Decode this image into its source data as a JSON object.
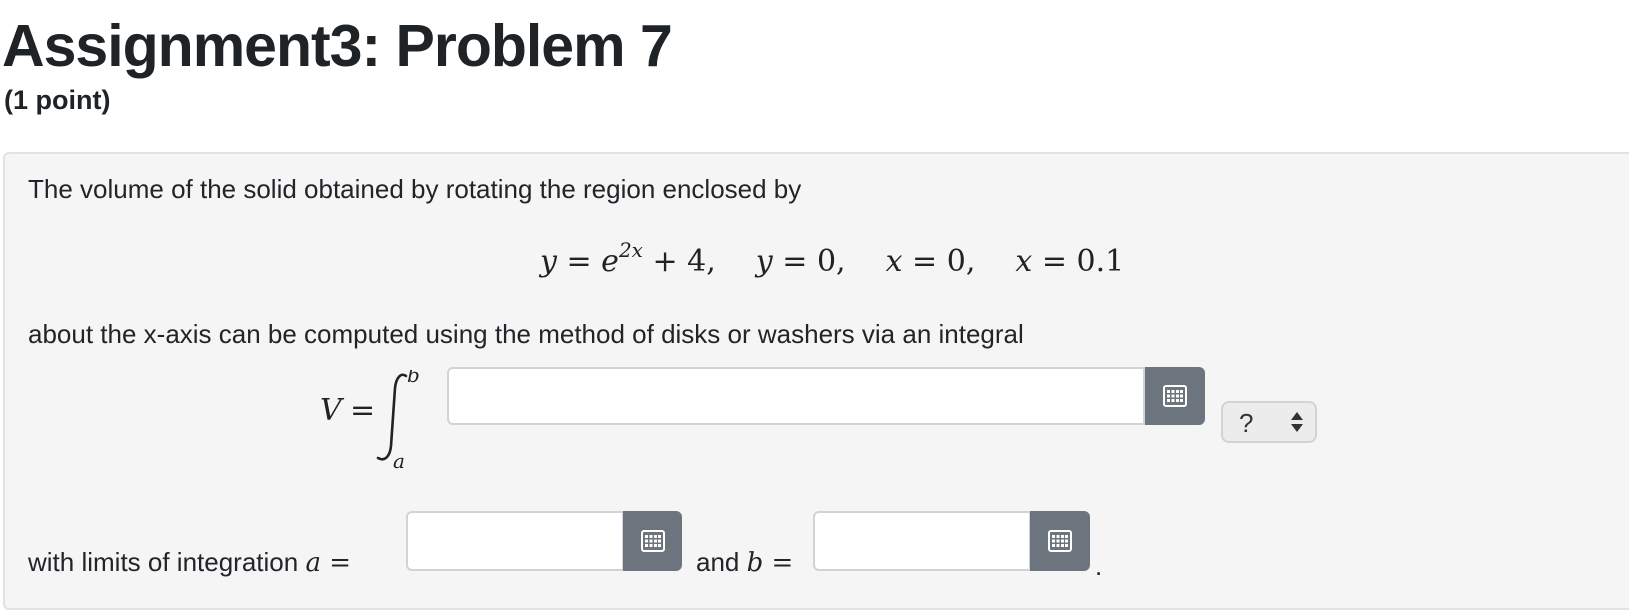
{
  "header": {
    "title": "Assignment3: Problem 7",
    "points": "(1 point)"
  },
  "problem": {
    "intro": "The volume of the solid obtained by rotating the region enclosed by",
    "display_eq": {
      "eq1": {
        "lhs": "y",
        "op": " = ",
        "base": "e",
        "exp": "2x",
        "rest": " + 4,"
      },
      "eq2": {
        "lhs": "y",
        "op": " = ",
        "rhs": "0,"
      },
      "eq3": {
        "lhs": "x",
        "op": " = ",
        "rhs": "0,"
      },
      "eq4": {
        "lhs": "x",
        "op": " = ",
        "rhs": "0.1"
      }
    },
    "method_text": "about the x-axis can be computed using the method of disks or washers via an integral",
    "integral": {
      "lhs": "V",
      "eq": "=",
      "upper": "b",
      "lower": "a"
    },
    "integrand_input": {
      "value": "",
      "placeholder": ""
    },
    "method_select": {
      "selected": "?"
    },
    "limits": {
      "prefix": "with limits of integration ",
      "a_var": "a",
      "eq": " = ",
      "a_input": {
        "value": ""
      },
      "and_text": "and ",
      "b_var": "b",
      "b_input": {
        "value": ""
      },
      "period": "."
    }
  },
  "icons": {
    "keyboard": "matrix-keyboard-icon",
    "select_arrows": "up-down-arrows-icon"
  },
  "colors": {
    "panel_bg": "#f5f5f5",
    "keyboard_button": "#6c757d",
    "title_text": "#1f2326"
  }
}
